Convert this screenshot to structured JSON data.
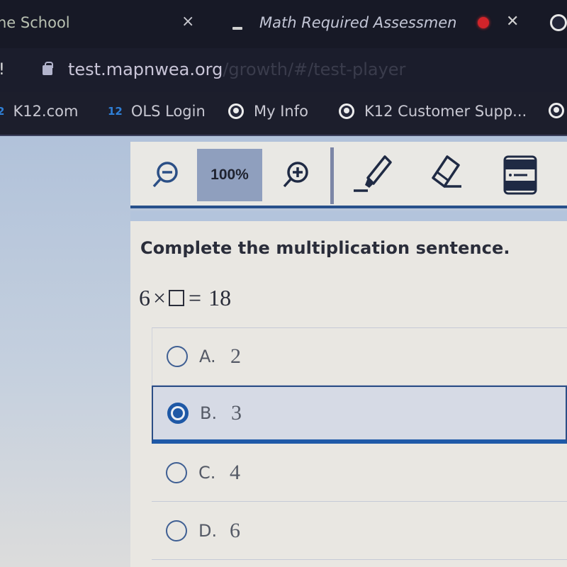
{
  "browser": {
    "tabs": [
      {
        "title": "ne School",
        "close": "×"
      },
      {
        "title": "Math Required Assessmen",
        "close": "×",
        "recording": true,
        "muted": true
      }
    ],
    "minimize_glyph": "—",
    "address": {
      "host": "test.mapnwea.org",
      "path": "/growth/#/test-player"
    },
    "bookmarks": [
      {
        "icon": "k12",
        "badge": "2",
        "label": "K12.com"
      },
      {
        "icon": "k12",
        "badge": "12",
        "label": "OLS Login"
      },
      {
        "icon": "globe",
        "label": "My Info"
      },
      {
        "icon": "globe",
        "label": "K12 Customer Supp..."
      },
      {
        "icon": "globe",
        "label": ""
      }
    ]
  },
  "toolbar": {
    "zoom_out": "zoom-out",
    "zoom_level": "100%",
    "zoom_in": "zoom-in",
    "tools": [
      "highlighter",
      "eraser",
      "line-reader"
    ]
  },
  "question": {
    "prompt": "Complete the multiplication sentence.",
    "equation": {
      "left": "6",
      "operator": "×",
      "equals": "=",
      "right": "18"
    },
    "options": [
      {
        "letter": "A.",
        "value": "2",
        "selected": false
      },
      {
        "letter": "B.",
        "value": "3",
        "selected": true
      },
      {
        "letter": "C.",
        "value": "4",
        "selected": false
      },
      {
        "letter": "D.",
        "value": "6",
        "selected": false
      }
    ]
  },
  "colors": {
    "accent": "#1e58a6",
    "toolbar_border": "#27508b",
    "zoom_level_bg": "#8f9fbe",
    "rec_dot": "#d1242a"
  }
}
